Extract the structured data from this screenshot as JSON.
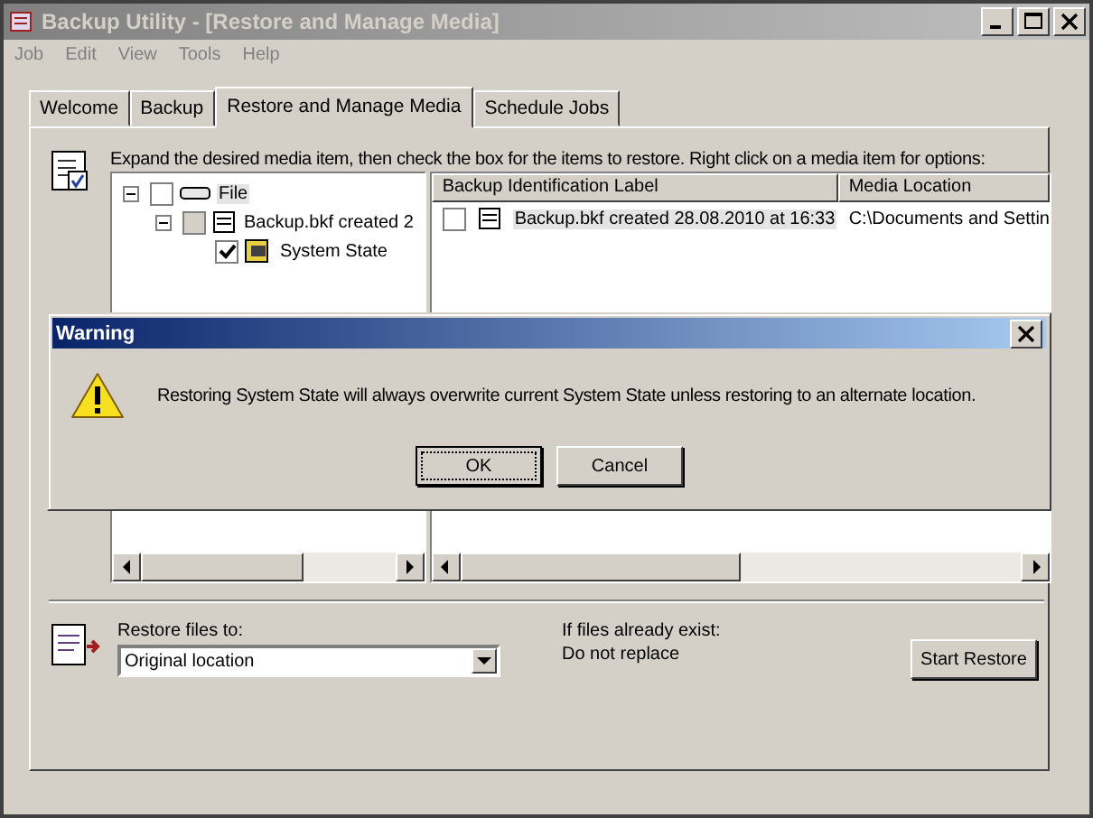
{
  "window": {
    "title": "Backup Utility - [Restore and Manage Media]"
  },
  "menu": [
    "Job",
    "Edit",
    "View",
    "Tools",
    "Help"
  ],
  "tabs": [
    {
      "label": "Welcome",
      "selected": false
    },
    {
      "label": "Backup",
      "selected": false
    },
    {
      "label": "Restore and Manage Media",
      "selected": true
    },
    {
      "label": "Schedule Jobs",
      "selected": false
    }
  ],
  "instruction": "Expand the desired media item, then check the box for the items to restore. Right click on a media item for options:",
  "tree": [
    {
      "label": "File",
      "checked": false,
      "greyed": false,
      "selected": true,
      "expanded": true,
      "kind": "media",
      "children": [
        {
          "label": "Backup.bkf created 2",
          "checked": false,
          "greyed": true,
          "selected": false,
          "expanded": true,
          "kind": "file",
          "children": [
            {
              "label": "System State",
              "checked": true,
              "greyed": false,
              "selected": false,
              "kind": "state"
            }
          ]
        }
      ]
    }
  ],
  "list": {
    "columns": [
      "Backup Identification Label",
      "Media Location"
    ],
    "rows": [
      {
        "checked": false,
        "selected": true,
        "label": "Backup.bkf created 28.08.2010 at 16:33",
        "location": "C:\\Documents and Settin"
      }
    ]
  },
  "restore_to": {
    "label": "Restore files to:",
    "value": "Original location"
  },
  "if_exist": {
    "label": "If files already exist:",
    "value": "Do not replace"
  },
  "start_button": "Start Restore",
  "dialog": {
    "title": "Warning",
    "message": "Restoring System State will always overwrite current System State unless restoring to an alternate location.",
    "buttons": [
      {
        "label": "OK",
        "selected": true
      },
      {
        "label": "Cancel",
        "selected": false
      }
    ]
  }
}
